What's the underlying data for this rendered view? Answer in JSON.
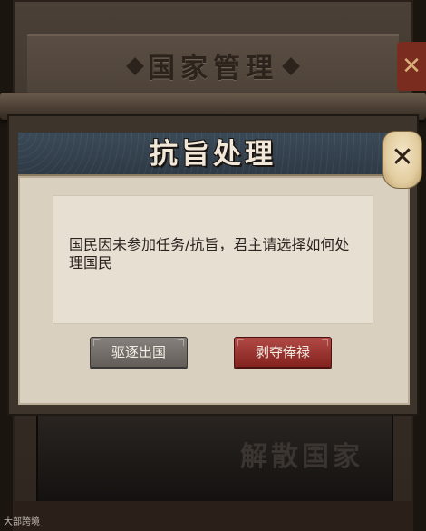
{
  "background_panel": {
    "title": "国家管理",
    "close_glyph": "✕",
    "disband_label": "解散国家"
  },
  "dialog": {
    "title": "抗旨处理",
    "message": "国民因未参加任务/抗旨，君主请选择如何处理国民",
    "buttons": {
      "expel": "驱逐出国",
      "strip_salary": "剥夺俸禄"
    },
    "close_glyph": "✕"
  },
  "watermark": "大部跨境",
  "colors": {
    "expel_button": "#6f6a66",
    "strip_salary_button": "#9a2f2b",
    "dialog_header": "#34414e",
    "dialog_body": "#d9d0c0"
  },
  "icons": {
    "close": "close-icon"
  }
}
